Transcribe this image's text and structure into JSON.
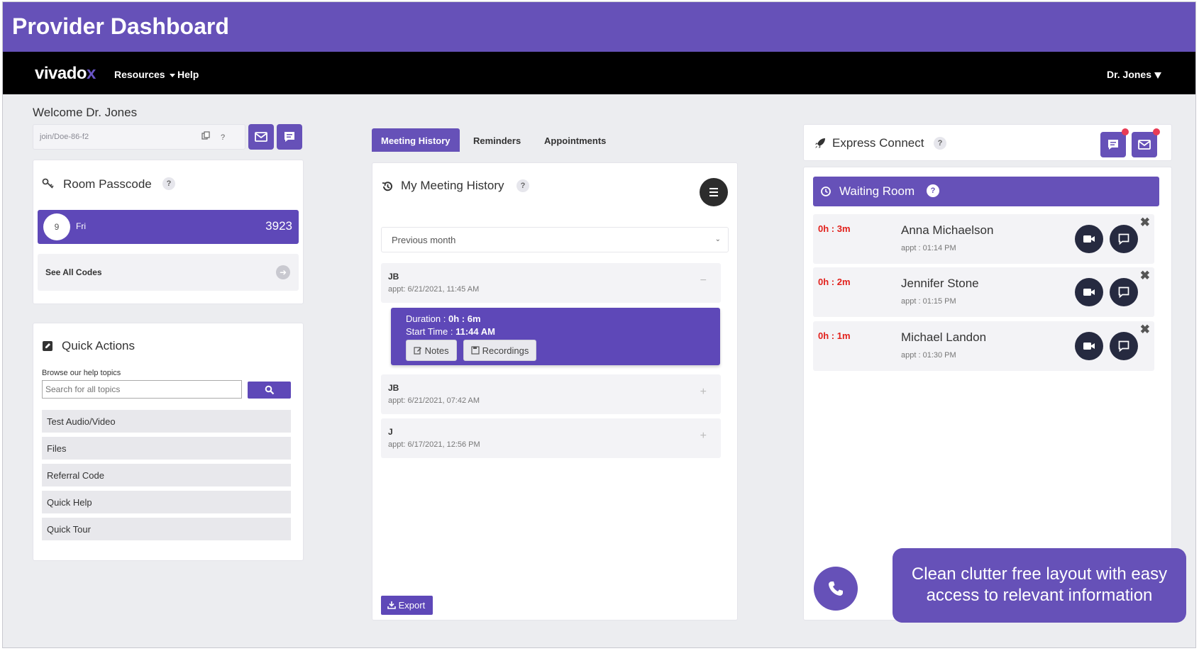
{
  "banner": {
    "title": "Provider Dashboard"
  },
  "navbar": {
    "brand_main": "vivado",
    "brand_x": "x",
    "menu": [
      {
        "label": "Resources"
      },
      {
        "label": "Help"
      }
    ],
    "user_label": "Dr. Jones"
  },
  "left": {
    "welcome": "Welcome Dr. Jones",
    "room_link": "join/Doe-86-f2",
    "room_passcode": {
      "title": "Room Passcode",
      "day_number": "9",
      "day_name": "Fri",
      "code": "3923",
      "see_all": "See All Codes"
    },
    "quick_actions": {
      "title": "Quick Actions",
      "subtitle": "Browse our help topics",
      "search_placeholder": "Search for all topics",
      "items": [
        {
          "label": "Test Audio/Video"
        },
        {
          "label": "Files"
        },
        {
          "label": "Referral Code"
        },
        {
          "label": "Quick Help"
        },
        {
          "label": "Quick Tour"
        }
      ]
    }
  },
  "center": {
    "tabs": [
      {
        "label": "Meeting History",
        "active": true
      },
      {
        "label": "Reminders"
      },
      {
        "label": "Appointments"
      }
    ],
    "history": {
      "title": "My Meeting History",
      "period": "Previous month",
      "meetings": [
        {
          "initials": "JB",
          "appt": "appt: 6/21/2021, 11:45 AM",
          "expanded": true
        },
        {
          "initials": "JB",
          "appt": "appt: 6/21/2021, 07:42 AM"
        },
        {
          "initials": "J",
          "appt": "appt: 6/17/2021, 12:56 PM"
        }
      ],
      "detail": {
        "duration_label": "Duration : ",
        "duration_value": "0h : 6m",
        "start_label": "Start Time : ",
        "start_value": "11:44 AM",
        "notes_label": "Notes",
        "recordings_label": "Recordings"
      },
      "export_label": "Export"
    }
  },
  "right": {
    "express_connect": {
      "title": "Express Connect"
    },
    "waiting_room": {
      "title": "Waiting Room",
      "patients": [
        {
          "wait": "0h : 3m",
          "name": "Anna Michaelson",
          "appt": "appt : 01:14 PM"
        },
        {
          "wait": "0h : 2m",
          "name": "Jennifer Stone",
          "appt": "appt : 01:15 PM"
        },
        {
          "wait": "0h : 1m",
          "name": "Michael Landon",
          "appt": "appt : 01:30 PM"
        }
      ]
    },
    "callout": "Clean clutter free layout with easy access to relevant information"
  },
  "colors": {
    "accent": "#6651b8",
    "wait_time": "#e2211c",
    "navbar": "#000000"
  }
}
